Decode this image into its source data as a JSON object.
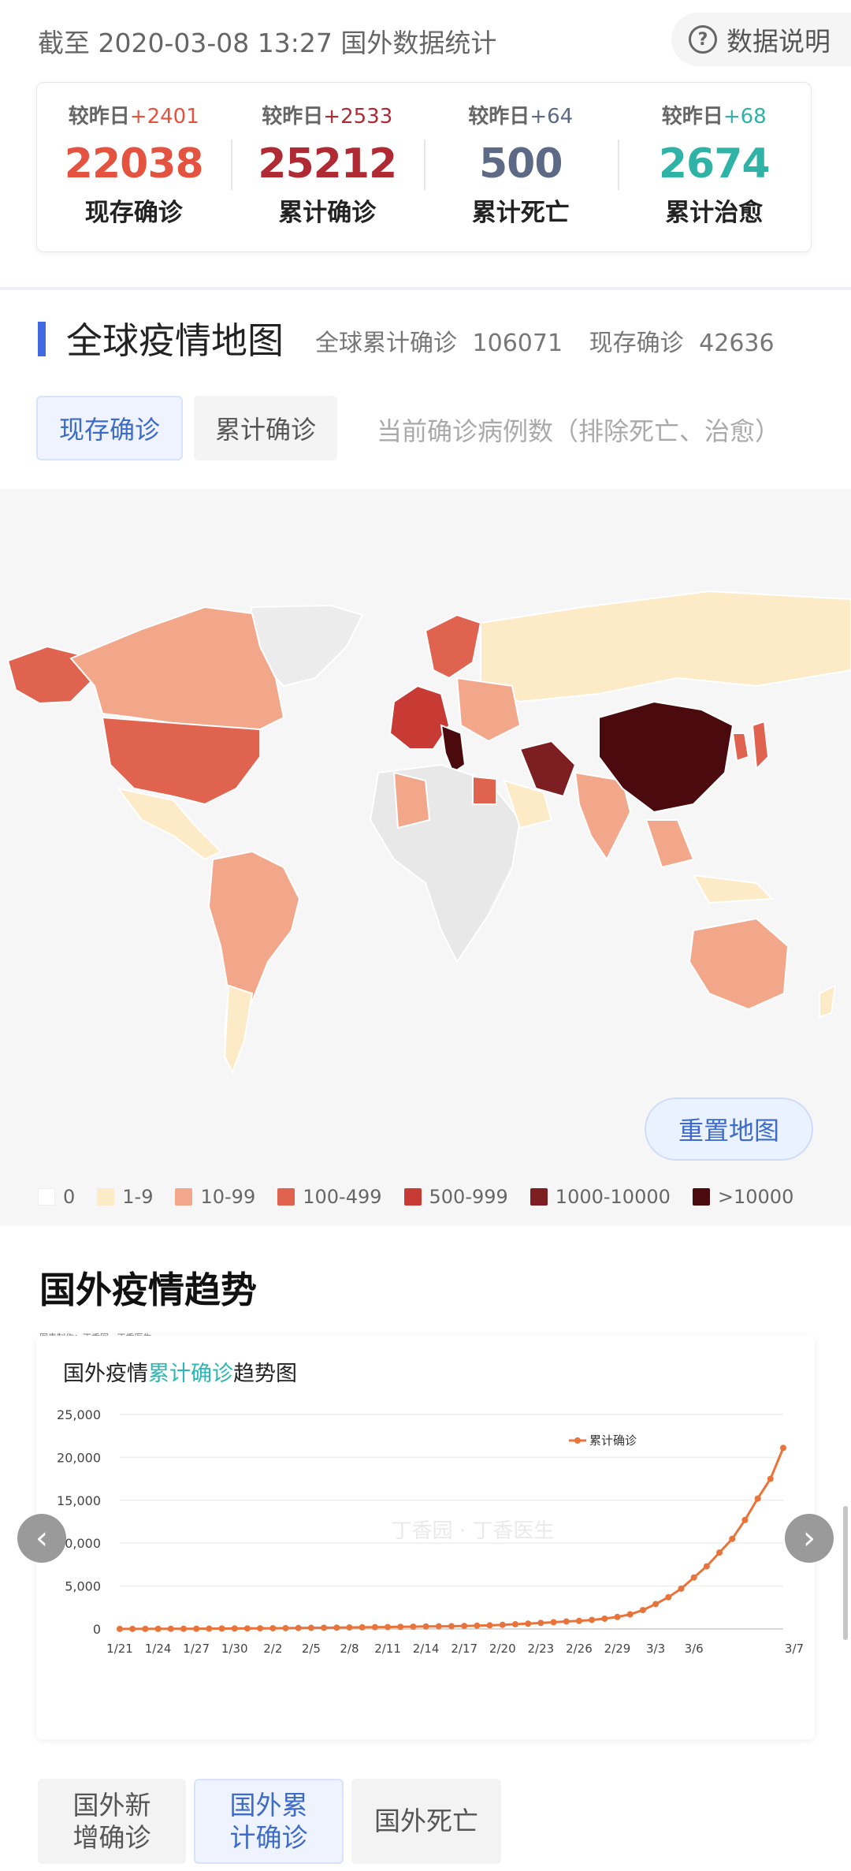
{
  "header": {
    "as_of": "截至 2020-03-08 13:27 国外数据统计",
    "explain_button": "数据说明"
  },
  "stats": [
    {
      "compare_label": "较昨日",
      "delta": "+2401",
      "value": "22038",
      "label": "现存确诊",
      "color": "#e4533f"
    },
    {
      "compare_label": "较昨日",
      "delta": "+2533",
      "value": "25212",
      "label": "累计确诊",
      "color": "#b02a33"
    },
    {
      "compare_label": "较昨日",
      "delta": "+64",
      "value": "500",
      "label": "累计死亡",
      "color": "#5c6a86"
    },
    {
      "compare_label": "较昨日",
      "delta": "+68",
      "value": "2674",
      "label": "累计治愈",
      "color": "#2fb3a7"
    }
  ],
  "map_section": {
    "title": "全球疫情地图",
    "global_cumulative_label": "全球累计确诊",
    "global_cumulative_value": "106071",
    "global_current_label": "现存确诊",
    "global_current_value": "42636",
    "tabs": [
      {
        "label": "现存确诊",
        "active": true
      },
      {
        "label": "累计确诊",
        "active": false
      }
    ],
    "tab_description": "当前确诊病例数（排除死亡、治愈）",
    "reset_button": "重置地图",
    "legend": [
      {
        "label": "0",
        "color": "#ffffff"
      },
      {
        "label": "1-9",
        "color": "#fdebc8"
      },
      {
        "label": "10-99",
        "color": "#f2a78a"
      },
      {
        "label": "100-499",
        "color": "#e06350"
      },
      {
        "label": "500-999",
        "color": "#c83a34"
      },
      {
        "label": "1000-10000",
        "color": "#7d1f22"
      },
      {
        "label": ">10000",
        "color": "#4a0a0e"
      }
    ]
  },
  "trend_section": {
    "title": "国外疫情趋势",
    "credit": "图表制作：丁香园 · 丁香医生",
    "chart_title_prefix": "国外疫情",
    "chart_title_highlight": "累计确诊",
    "chart_title_suffix": "趋势图",
    "watermark": "丁香园 · 丁香医生",
    "bottom_tabs": [
      {
        "label": "国外新增确诊",
        "active": false
      },
      {
        "label": "国外累计确诊",
        "active": true
      },
      {
        "label": "国外死亡",
        "active": false
      }
    ]
  },
  "chart_data": {
    "type": "line",
    "title": "国外疫情累计确诊趋势图",
    "series": [
      {
        "name": "累计确诊",
        "color": "#e8743b",
        "values": [
          4,
          5,
          8,
          11,
          14,
          18,
          23,
          33,
          45,
          53,
          62,
          72,
          85,
          95,
          111,
          127,
          138,
          155,
          178,
          195,
          210,
          224,
          246,
          266,
          290,
          305,
          320,
          350,
          380,
          420,
          480,
          550,
          620,
          700,
          780,
          870,
          940,
          1050,
          1200,
          1400,
          1700,
          2200,
          2900,
          3700,
          4700,
          6000,
          7300,
          8900,
          10500,
          12700,
          15200,
          17500,
          21100
        ]
      }
    ],
    "ylim": [
      0,
      25000
    ],
    "yticks": [
      "0",
      "5,000",
      "10,000",
      "15,000",
      "20,000",
      "25,000"
    ],
    "xtick_labels": [
      "1/21",
      "1/24",
      "1/27",
      "1/30",
      "2/2",
      "2/5",
      "2/8",
      "2/11",
      "2/14",
      "2/17",
      "2/20",
      "2/23",
      "2/26",
      "2/29",
      "3/3",
      "3/6",
      "3/7"
    ],
    "legend_position": "top-right",
    "grid": true
  }
}
